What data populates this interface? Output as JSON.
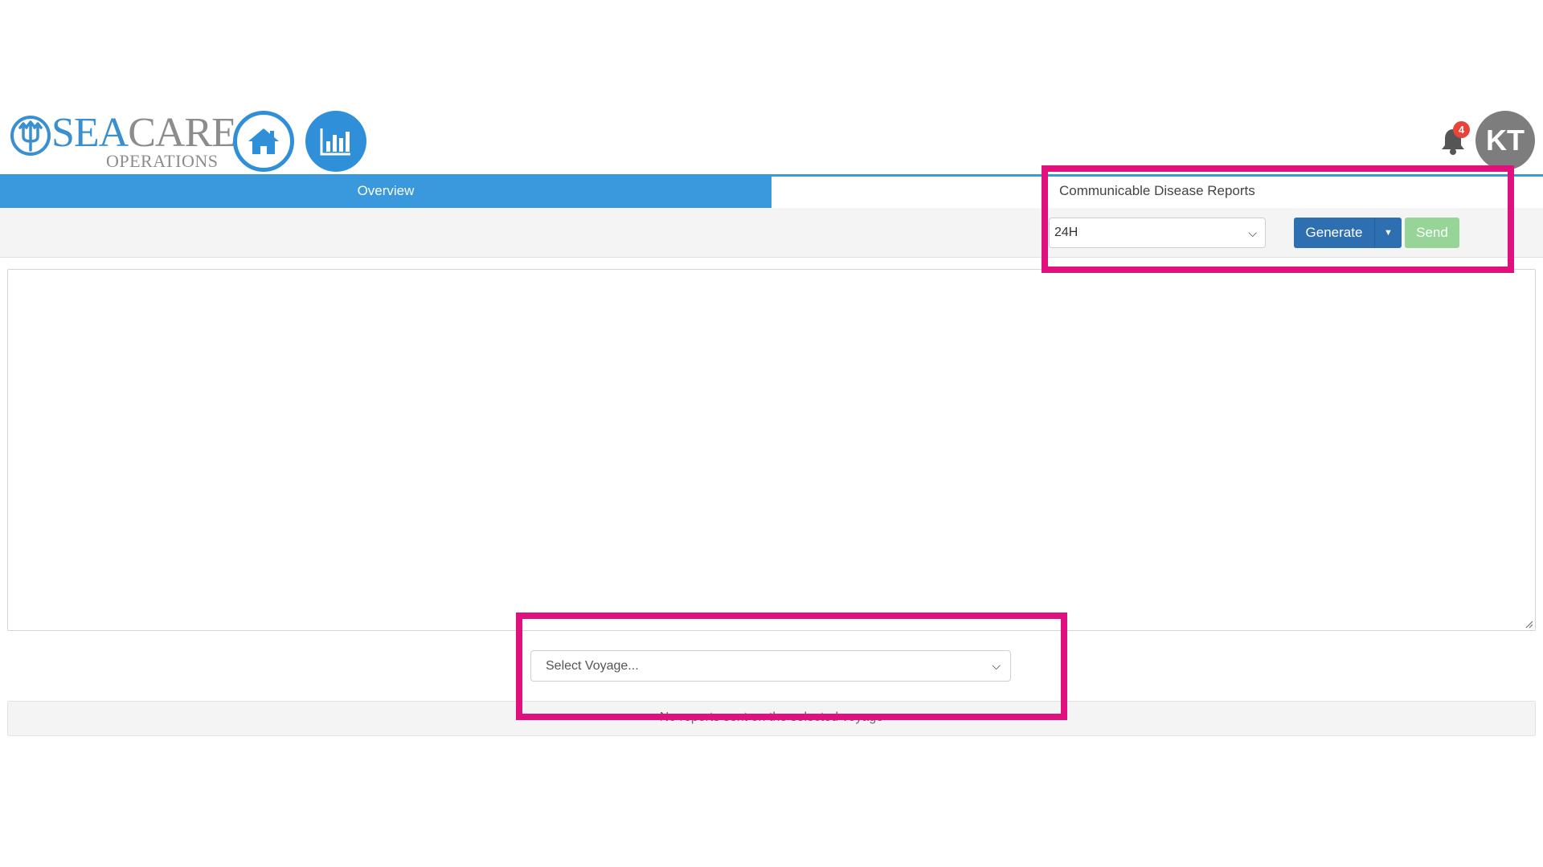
{
  "app": {
    "logo_main_blue": "SEA",
    "logo_main_gray": "CARE",
    "logo_sub": "OPERATIONS"
  },
  "header": {
    "home_icon": "home-icon",
    "analytics_icon": "bar-chart-icon",
    "notifications_icon": "bell-icon",
    "notification_count": "4",
    "user_initials": "KT"
  },
  "tabs": {
    "overview_label": "Overview",
    "reports_label": "Communicable Disease Reports"
  },
  "toolbar": {
    "period_value": "24H",
    "generate_label": "Generate",
    "send_label": "Send"
  },
  "voyage": {
    "placeholder": "Select Voyage..."
  },
  "reports": {
    "empty_message": "No reports sent on the selected voyage"
  },
  "colors": {
    "brand_blue": "#3a98dc",
    "generate_blue": "#2e6fb1",
    "send_green": "#96d597",
    "highlight_magenta": "#e0117f",
    "badge_red": "#e8443a"
  }
}
